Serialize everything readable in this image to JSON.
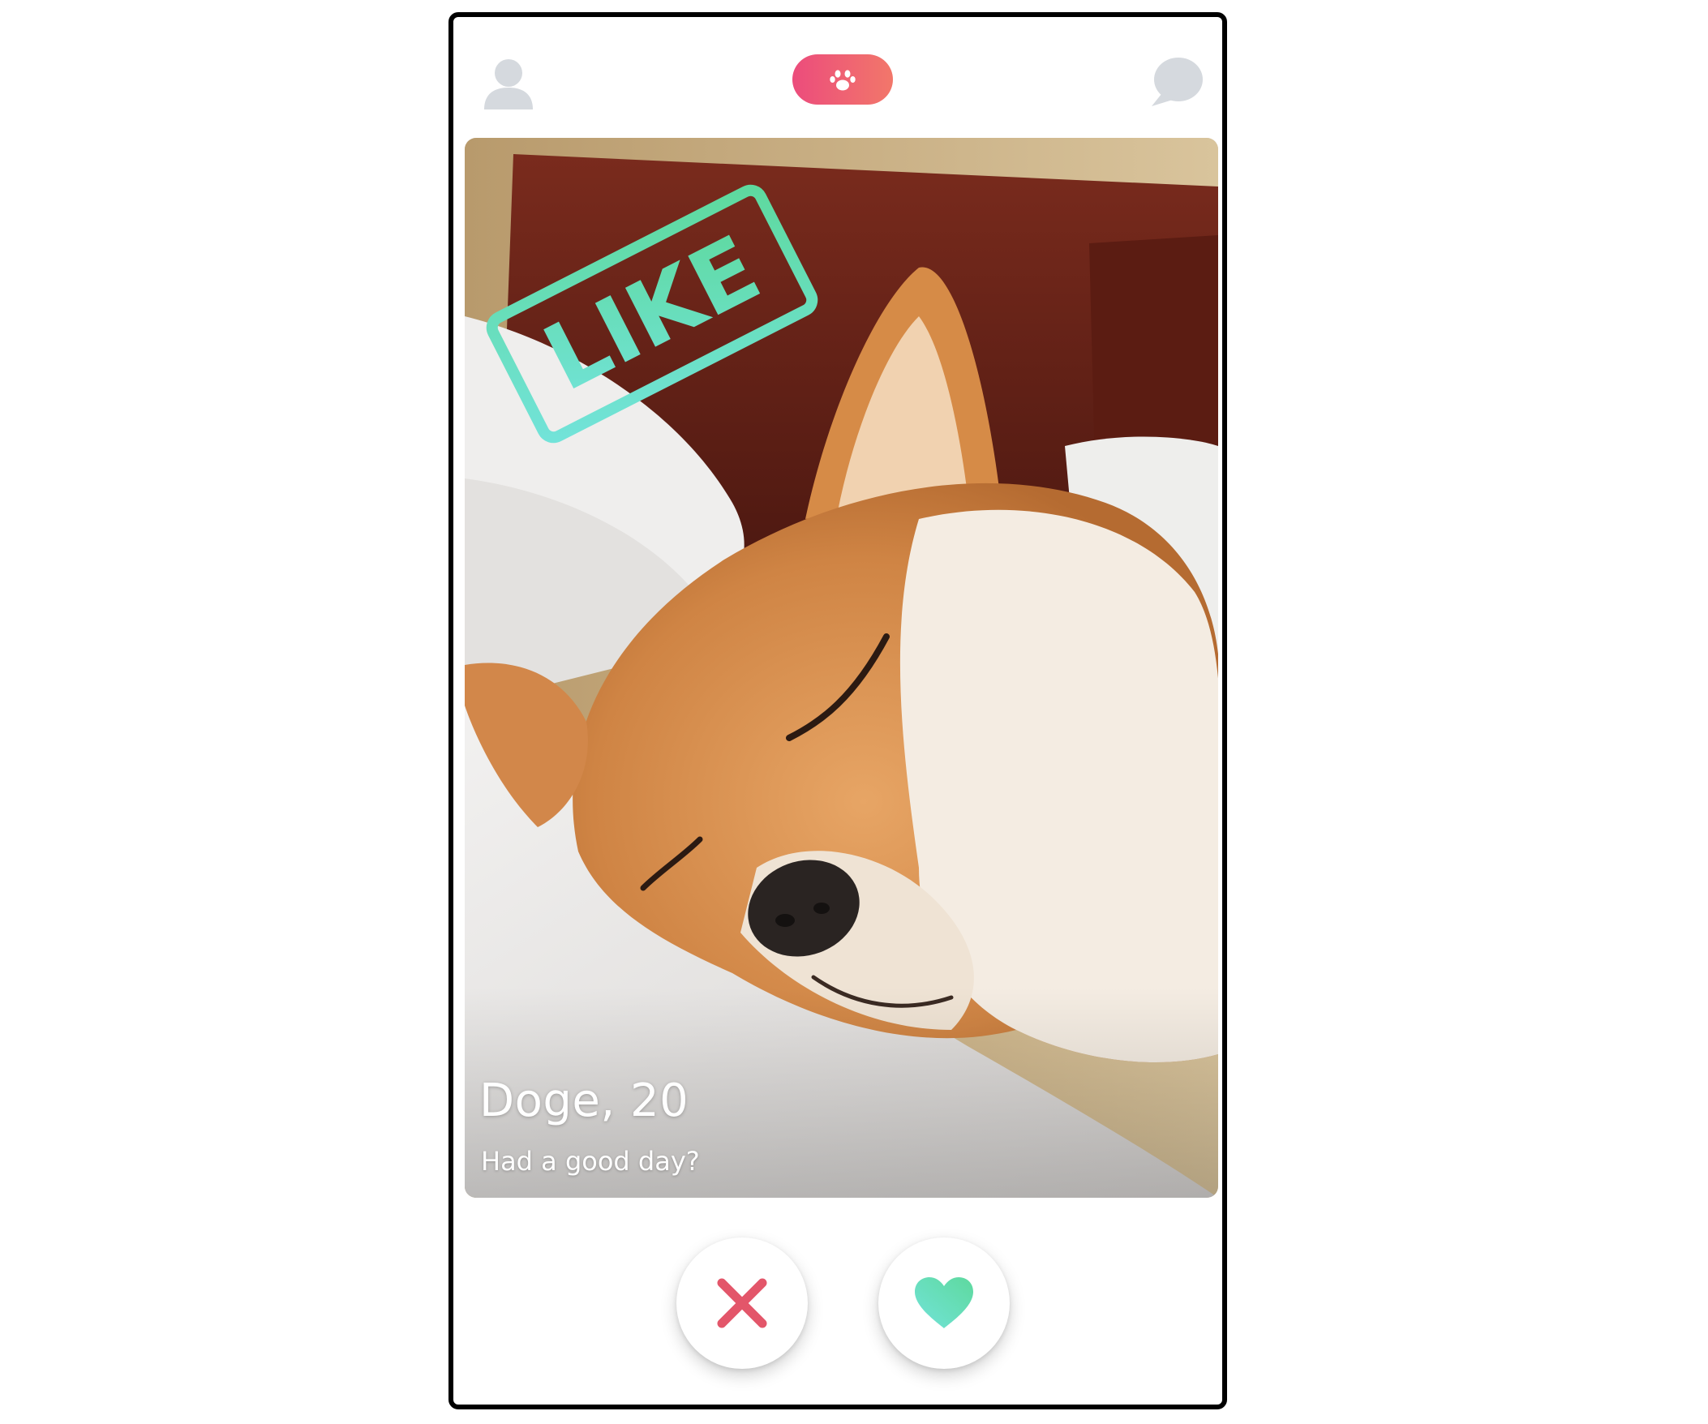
{
  "header": {
    "profile_icon": "user-icon",
    "logo_icon": "paw-icon",
    "chat_icon": "chat-bubble-icon"
  },
  "card": {
    "name_age": "Doge, 20",
    "bio": "Had a good day?",
    "stamp_label": "LIKE",
    "photo_subject": "shiba-inu-photo"
  },
  "actions": {
    "dislike_icon": "close-icon",
    "like_icon": "heart-icon"
  },
  "colors": {
    "brand_gradient_start": "#ec4c7c",
    "brand_gradient_end": "#f2776a",
    "icon_gray": "#d5d9de",
    "like_green_start": "#72e3d9",
    "like_green_end": "#5ed99e",
    "dislike_red": "#e3566a"
  }
}
